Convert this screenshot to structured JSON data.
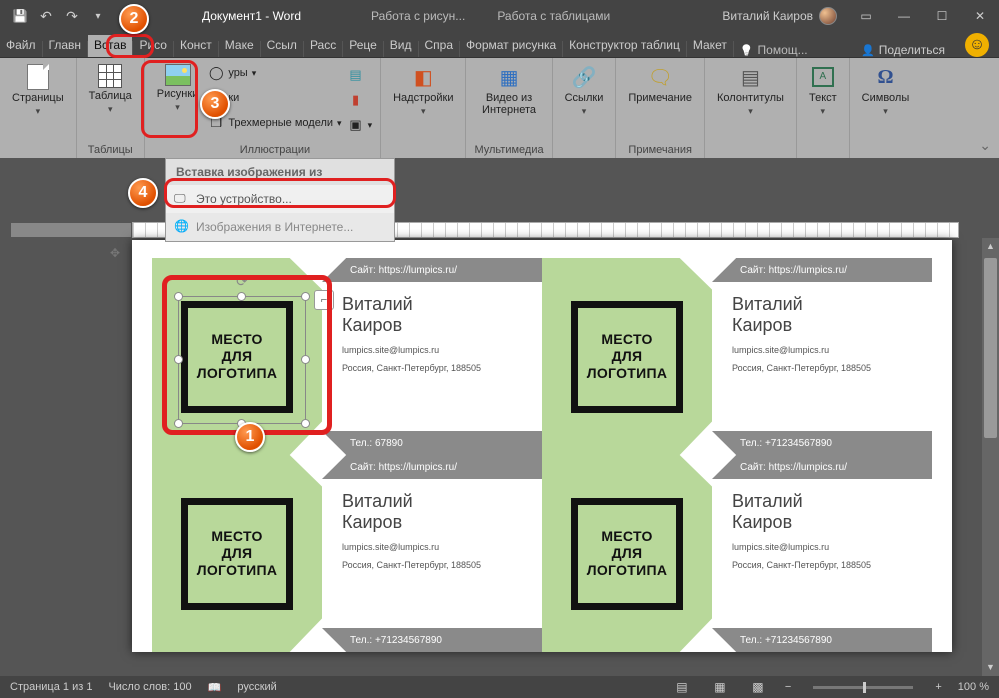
{
  "titlebar": {
    "doc_title": "Документ1 - Word",
    "context_tabs": [
      "Работа с рисун...",
      "Работа с таблицами"
    ],
    "user_name": "Виталий Каиров"
  },
  "menu": {
    "tabs": [
      "Файл",
      "Главн",
      "Встав",
      "Рисо",
      "Конст",
      "Маке",
      "Ссыл",
      "Расс",
      "Реце",
      "Вид",
      "Спра",
      "Формат рисунка",
      "Конструктор таблиц",
      "Макет"
    ],
    "tellme": "Помощ...",
    "share": "Поделиться"
  },
  "ribbon": {
    "pages": {
      "btn": "Страницы"
    },
    "tables": {
      "btn": "Таблица",
      "group": "Таблицы"
    },
    "illustr": {
      "pictures": "Рисунки",
      "shapes": "уры",
      "icons": "ки",
      "models": "Трехмерные модели",
      "group": "Иллюстрации"
    },
    "addins": {
      "btn": "Надстройки"
    },
    "media": {
      "btn": "Видео из\nИнтернета",
      "group": "Мультимедиа"
    },
    "links": {
      "btn": "Ссылки"
    },
    "comments": {
      "btn": "Примечание",
      "group": "Примечания"
    },
    "headers": {
      "btn": "Колонтитулы"
    },
    "text": {
      "btn": "Текст"
    },
    "symbols": {
      "btn": "Символы"
    }
  },
  "pic_menu": {
    "header": "Вставка изображения из",
    "item1": "Это устройство...",
    "item2": "Изображения в Интернете..."
  },
  "card": {
    "logo": {
      "l1": "МЕСТО",
      "l2": "ДЛЯ",
      "l3": "ЛОГОТИПА"
    },
    "site_label": "Сайт: https://lumpics.ru/",
    "name_first": "Виталий",
    "name_last": "Каиров",
    "email": "lumpics.site@lumpics.ru",
    "addr": "Россия, Санкт-Петербург, 188505",
    "tel_full": "Тел.: +71234567890",
    "tel_cut": "Тел.:          67890"
  },
  "status": {
    "page": "Страница 1 из 1",
    "words": "Число слов: 100",
    "lang": "русский",
    "zoom": "100 %"
  },
  "badges": {
    "b1": "1",
    "b2": "2",
    "b3": "3",
    "b4": "4"
  }
}
